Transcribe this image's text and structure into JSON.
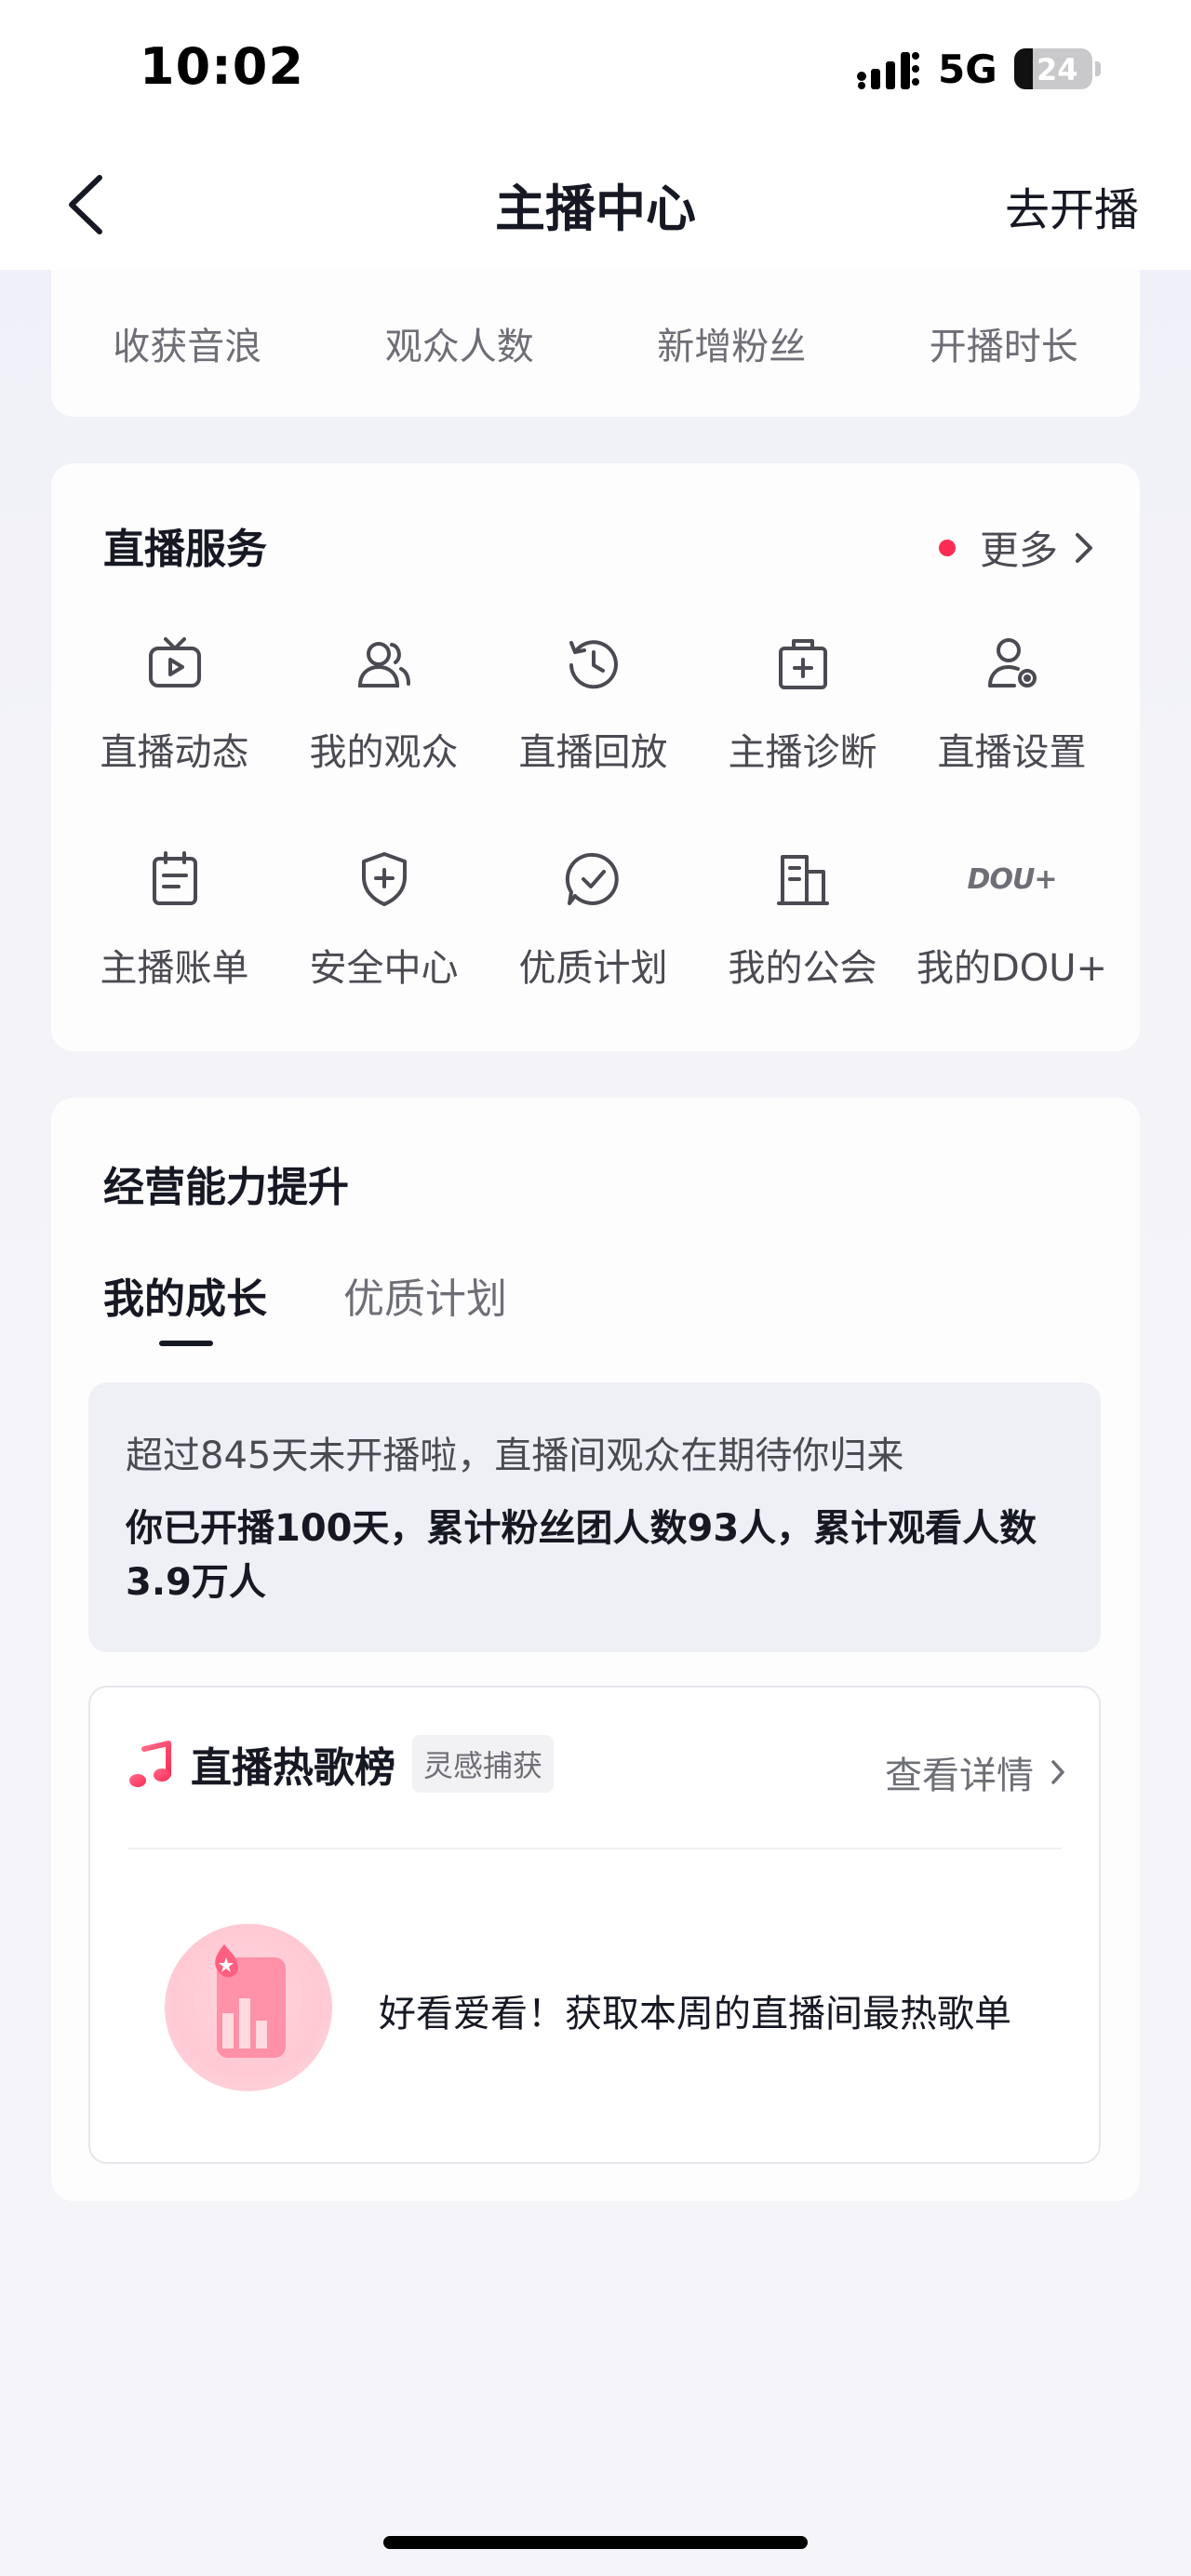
{
  "status_bar": {
    "time": "10:02",
    "network": "5G",
    "battery": "24"
  },
  "nav": {
    "title": "主播中心",
    "action": "去开播"
  },
  "stats": {
    "labels": [
      "收获音浪",
      "观众人数",
      "新增粉丝",
      "开播时长"
    ]
  },
  "services": {
    "title": "直播服务",
    "more": "更多",
    "items": [
      {
        "label": "直播动态",
        "icon": "tv-play-icon"
      },
      {
        "label": "我的观众",
        "icon": "users-icon"
      },
      {
        "label": "直播回放",
        "icon": "history-icon"
      },
      {
        "label": "主播诊断",
        "icon": "medical-kit-icon"
      },
      {
        "label": "直播设置",
        "icon": "user-settings-icon"
      },
      {
        "label": "主播账单",
        "icon": "bill-icon"
      },
      {
        "label": "安全中心",
        "icon": "shield-icon"
      },
      {
        "label": "优质计划",
        "icon": "check-chat-icon"
      },
      {
        "label": "我的公会",
        "icon": "building-icon"
      },
      {
        "label": "我的DOU+",
        "icon": "dou-logo-icon",
        "logo_text": "DOU+"
      }
    ]
  },
  "growth": {
    "title": "经营能力提升",
    "tabs": [
      "我的成长",
      "优质计划"
    ],
    "active_tab": "我的成长",
    "line1": "超过845天未开播啦，直播间观众在期待你归来",
    "line2": "你已开播100天，累计粉丝团人数93人，累计观看人数3.9万人"
  },
  "hot_songs": {
    "title": "直播热歌榜",
    "tag": "灵感捕获",
    "detail": "查看详情",
    "description": "好看爱看！获取本周的直播间最热歌单"
  },
  "colors": {
    "accent": "#fe2c55",
    "text_primary": "#161823",
    "text_secondary": "#6e6f76"
  }
}
